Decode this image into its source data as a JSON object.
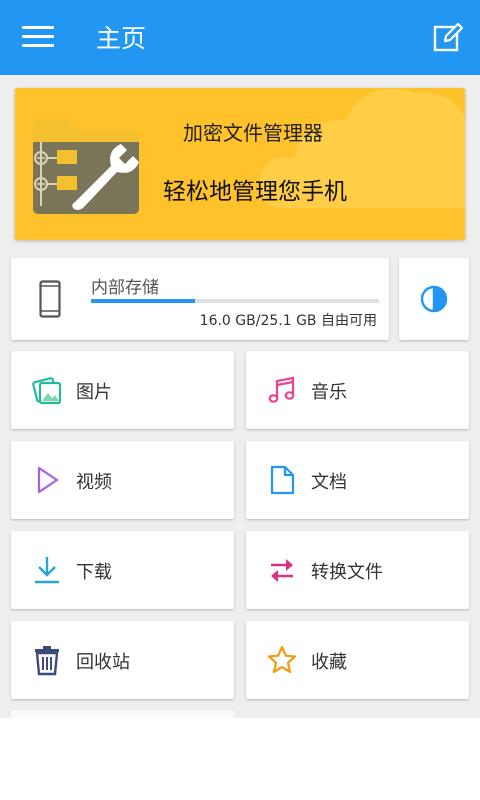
{
  "appbar": {
    "title": "主页",
    "menu_icon": "menu-icon",
    "edit_icon": "edit-icon",
    "color": "#2196f3"
  },
  "banner": {
    "title": "加密文件管理器",
    "subtitle": "轻松地管理您手机",
    "color": "#ffc22b"
  },
  "storage": {
    "label": "内部存储",
    "size_text": "16.0 GB/25.1 GB 自由可用",
    "used_fraction": 0.36
  },
  "categories": [
    {
      "label": "图片",
      "icon": "image-icon",
      "color": "#26b99a"
    },
    {
      "label": "音乐",
      "icon": "music-icon",
      "color": "#e84393"
    },
    {
      "label": "视频",
      "icon": "video-play-icon",
      "color": "#a55eea"
    },
    {
      "label": "文档",
      "icon": "document-icon",
      "color": "#2196f3"
    },
    {
      "label": "下载",
      "icon": "download-icon",
      "color": "#26a6d1"
    },
    {
      "label": "转换文件",
      "icon": "transfer-icon",
      "color": "#d63384"
    },
    {
      "label": "回收站",
      "icon": "trash-icon",
      "color": "#3b4a7a"
    },
    {
      "label": "收藏",
      "icon": "star-icon",
      "color": "#f39c12"
    }
  ]
}
